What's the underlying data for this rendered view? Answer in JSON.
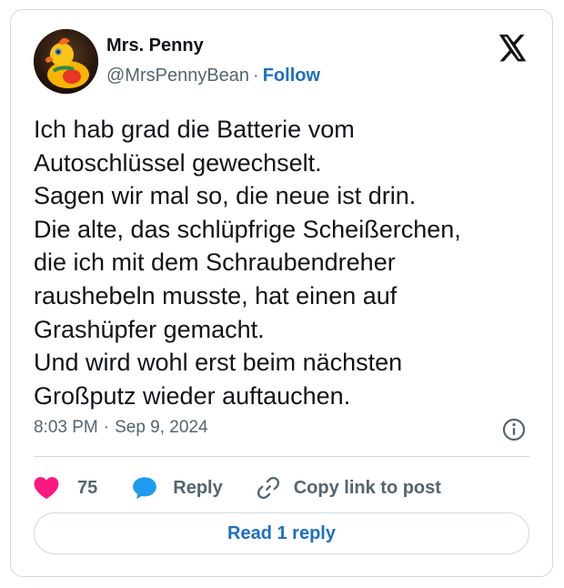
{
  "author": {
    "name": "Mrs. Penny",
    "handle": "@MrsPennyBean",
    "separator": "·",
    "follow_label": "Follow"
  },
  "tweet": {
    "text": "Ich hab grad die Batterie vom\nAutoschlüssel gewechselt.\nSagen wir mal so, die neue ist drin.\nDie alte, das schlüpfrige Scheißerchen,\ndie ich mit dem Schraubendreher\nraushebeln musste, hat einen auf\nGrashüpfer gemacht.\nUnd wird wohl erst beim nächsten\nGroßputz wieder auftauchen.",
    "time": "8:03 PM",
    "separator": "·",
    "date": "Sep 9, 2024"
  },
  "actions": {
    "like_count": "75",
    "reply_label": "Reply",
    "copy_link_label": "Copy link to post"
  },
  "read_replies_label": "Read 1 reply",
  "icons": {
    "brand": "x-logo",
    "info": "info-icon",
    "like": "heart-icon",
    "reply": "speech-bubble-icon",
    "copy": "link-icon"
  },
  "colors": {
    "accent": "#1d6fc2",
    "like": "#f91880",
    "reply_icon": "#1d9bf0",
    "muted_text": "#536471",
    "border": "#cfd9de"
  }
}
